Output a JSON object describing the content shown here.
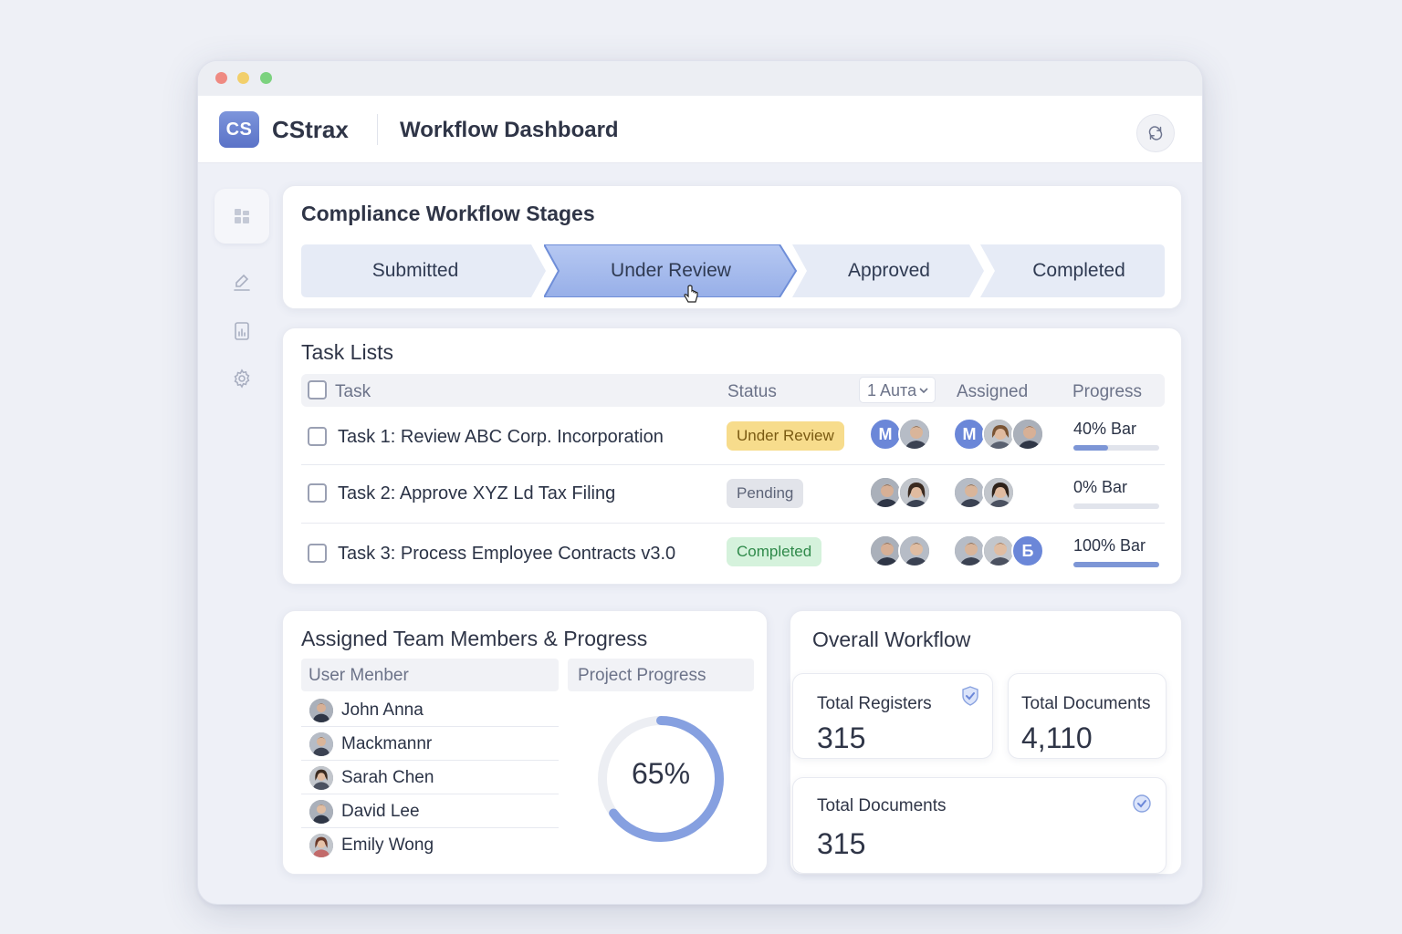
{
  "app": {
    "logo_text": "CS",
    "brand": "CStrax",
    "page_title": "Workflow Dashboard"
  },
  "stages": {
    "title": "Compliance Workflow Stages",
    "items": [
      {
        "label": "Submitted",
        "active": false
      },
      {
        "label": "Under Review",
        "active": true
      },
      {
        "label": "Approved",
        "active": false
      },
      {
        "label": "Completed",
        "active": false
      }
    ]
  },
  "tasks": {
    "title": "Task Lists",
    "headers": {
      "task": "Task",
      "status": "Status",
      "filter": "1 Auта",
      "assigned": "Assigned",
      "progress": "Progress"
    },
    "rows": [
      {
        "name": "Task 1: Review ABC Corp. Incorporation",
        "status": "Under Review",
        "status_color": "#f7dc8c",
        "status_text_color": "#7a5a12",
        "progress_label": "40% Bar",
        "progress": 40,
        "owners": [
          "M",
          "photo"
        ],
        "assigned": [
          "M",
          "photo",
          "photo"
        ]
      },
      {
        "name": "Task 2: Approve XYZ Ld Tax Filing",
        "status": "Pending",
        "status_color": "#e2e4ea",
        "status_text_color": "#5d6478",
        "progress_label": "0% Bar",
        "progress": 0,
        "owners": [
          "photo",
          "photo"
        ],
        "assigned": [
          "photo",
          "photo"
        ]
      },
      {
        "name": "Task 3: Process Employee Contracts v3.0",
        "status": "Completed",
        "status_color": "#d5f2dc",
        "status_text_color": "#2f8a4a",
        "progress_label": "100% Bar",
        "progress": 100,
        "owners": [
          "photo",
          "photo"
        ],
        "assigned": [
          "photo",
          "photo",
          "Б"
        ]
      }
    ]
  },
  "team": {
    "title": "Assigned Team Members & Progress",
    "col_member": "User Menber",
    "col_progress": "Project Progress",
    "members": [
      "John Anna",
      "Mackmannr",
      "Sarah Chen",
      "David Lee",
      "Emily Wong"
    ],
    "progress_text": "65%",
    "progress_value": 65
  },
  "overall": {
    "title": "Overall Workflow",
    "stats": [
      {
        "label": "Total Registers",
        "value": "315"
      },
      {
        "label": "Total Documents",
        "value": "4,110"
      },
      {
        "label": "Total Documents",
        "value": "315"
      }
    ]
  },
  "colors": {
    "accent": "#6b87d8",
    "active_stage": "#a9bdf0",
    "stage_bg": "#e6ebf6"
  },
  "icons": {
    "sidebar": [
      "dashboard-icon",
      "sign-document-icon",
      "report-icon",
      "settings-icon"
    ],
    "appbar": "sync-icon",
    "stat_check": "check-badge-icon"
  }
}
